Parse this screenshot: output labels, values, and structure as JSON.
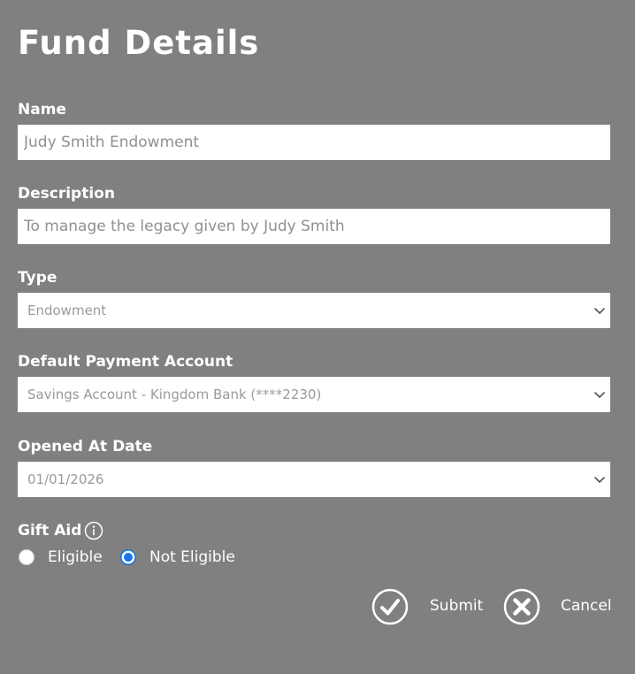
{
  "form": {
    "title": "Fund Details",
    "name": {
      "label": "Name",
      "value": "Judy Smith Endowment"
    },
    "description": {
      "label": "Description",
      "value": "To manage the legacy given by Judy Smith"
    },
    "type": {
      "label": "Type",
      "value": "Endowment",
      "icon": "chevron-down-icon"
    },
    "default_payment_account": {
      "label": "Default Payment Account",
      "value": "Savings Account - Kingdom Bank (****2230)",
      "icon": "chevron-down-icon"
    },
    "opened_at_date": {
      "label": "Opened At Date",
      "value": "01/01/2026",
      "icon": "chevron-down-icon"
    },
    "gift_aid": {
      "label": "Gift Aid",
      "info_icon": "info-icon",
      "options": [
        {
          "label": "Eligible",
          "selected": false
        },
        {
          "label": "Not Eligible",
          "selected": true
        }
      ]
    }
  },
  "actions": {
    "submit": {
      "label": "Submit",
      "icon": "checkmark-circle-icon"
    },
    "cancel": {
      "label": "Cancel",
      "icon": "close-circle-icon"
    }
  },
  "colors": {
    "background": "#808080",
    "text": "#ffffff",
    "input_background": "#ffffff",
    "input_text": "#909090",
    "radio_selected": "#1a73e8"
  }
}
